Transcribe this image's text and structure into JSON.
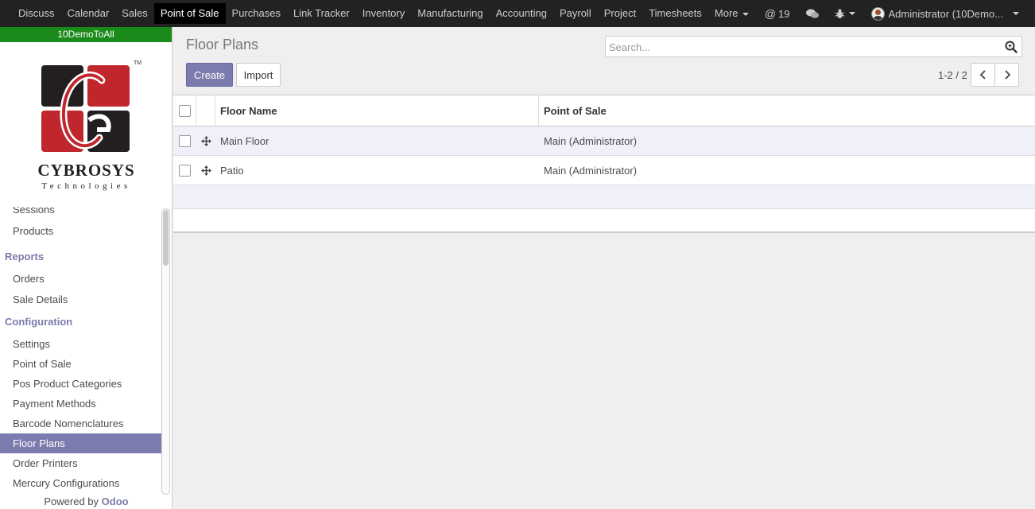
{
  "topbar": {
    "apps": [
      "Discuss",
      "Calendar",
      "Sales",
      "Point of Sale",
      "Purchases",
      "Link Tracker",
      "Inventory",
      "Manufacturing",
      "Accounting",
      "Payroll",
      "Project",
      "Timesheets"
    ],
    "active_app": "Point of Sale",
    "more_label": "More",
    "mentions_count": "19",
    "user_label": "Administrator (10Demo..."
  },
  "sidebar": {
    "db_name": "10DemoToAll",
    "logo_name": "CYBROSYS",
    "logo_sub": "Technologies",
    "items_top": [
      {
        "label": "Sessions"
      },
      {
        "label": "Products"
      }
    ],
    "reports_header": "Reports",
    "reports_items": [
      {
        "label": "Orders"
      },
      {
        "label": "Sale Details"
      }
    ],
    "config_header": "Configuration",
    "config_items": [
      {
        "label": "Settings"
      },
      {
        "label": "Point of Sale"
      },
      {
        "label": "Pos Product Categories"
      },
      {
        "label": "Payment Methods"
      },
      {
        "label": "Barcode Nomenclatures"
      },
      {
        "label": "Floor Plans"
      },
      {
        "label": "Order Printers"
      },
      {
        "label": "Mercury Configurations"
      }
    ],
    "active_item": "Floor Plans",
    "powered_by": "Powered by",
    "powered_brand": "Odoo"
  },
  "main": {
    "title": "Floor Plans",
    "create_label": "Create",
    "import_label": "Import",
    "search_placeholder": "Search...",
    "pager_text": "1-2 / 2",
    "columns": [
      "Floor Name",
      "Point of Sale"
    ],
    "rows": [
      {
        "name": "Main Floor",
        "pos": "Main (Administrator)"
      },
      {
        "name": "Patio",
        "pos": "Main (Administrator)"
      }
    ]
  },
  "colors": {
    "accent": "#7c7bad",
    "topbar": "#222222",
    "db_banner": "#1a8a1a",
    "logo_red": "#c0272d",
    "logo_dark": "#231f20"
  }
}
